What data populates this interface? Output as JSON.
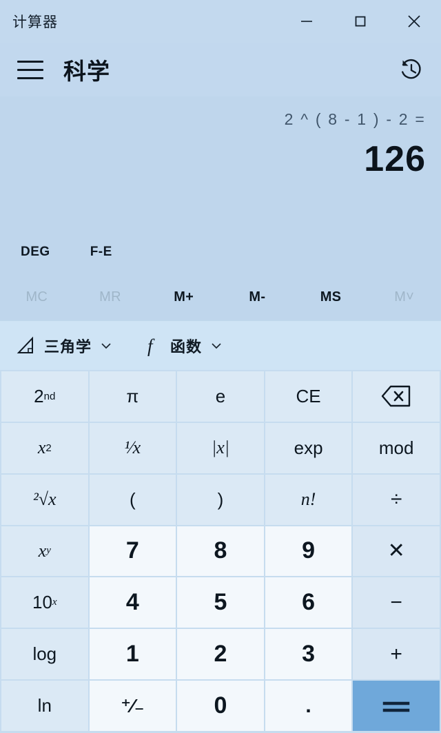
{
  "window": {
    "title": "计算器",
    "controls": [
      {
        "name": "minimize",
        "label": "—"
      },
      {
        "name": "maximize",
        "label": "□"
      },
      {
        "name": "close",
        "label": "✕"
      }
    ]
  },
  "header": {
    "menu_icon": "hamburger-icon",
    "mode_title": "科学",
    "history_icon": "history-icon"
  },
  "display": {
    "expression": "2 ^ ( 8 - 1 ) - 2 =",
    "result": "126"
  },
  "toggles": [
    {
      "label": "DEG",
      "name": "angle-unit-toggle",
      "enabled": true
    },
    {
      "label": "F-E",
      "name": "fixed-exponential-toggle",
      "enabled": true
    }
  ],
  "memory": [
    {
      "label": "MC",
      "name": "memory-clear",
      "enabled": false
    },
    {
      "label": "MR",
      "name": "memory-recall",
      "enabled": false
    },
    {
      "label": "M+",
      "name": "memory-add",
      "enabled": true
    },
    {
      "label": "M-",
      "name": "memory-subtract",
      "enabled": true
    },
    {
      "label": "MS",
      "name": "memory-store",
      "enabled": true
    },
    {
      "label": "M˅",
      "name": "memory-list",
      "enabled": false
    }
  ],
  "toolbar": [
    {
      "label": "三角学",
      "name": "trigonometry-menu",
      "icon": "triangle-icon"
    },
    {
      "label": "函数",
      "name": "function-menu",
      "icon": "function-f-icon"
    }
  ],
  "keypad": {
    "rows": [
      [
        {
          "name": "second-function",
          "text": "2",
          "sup": "nd",
          "kind": "fn"
        },
        {
          "name": "pi",
          "text": "π",
          "kind": "fn"
        },
        {
          "name": "euler-e",
          "text": "e",
          "kind": "fn"
        },
        {
          "name": "clear-entry",
          "text": "CE",
          "kind": "fn"
        },
        {
          "name": "backspace",
          "icon": "backspace-icon",
          "kind": "fn"
        }
      ],
      [
        {
          "name": "square",
          "text": "x",
          "sup": "2",
          "italic": true,
          "kind": "fn"
        },
        {
          "name": "reciprocal",
          "text": "¹⁄x",
          "italic": true,
          "kind": "fn"
        },
        {
          "name": "absolute-value",
          "text": "|x|",
          "italic": true,
          "kind": "fn"
        },
        {
          "name": "exponent",
          "text": "exp",
          "kind": "fn"
        },
        {
          "name": "modulo",
          "text": "mod",
          "kind": "fn"
        }
      ],
      [
        {
          "name": "square-root",
          "text": "²√x",
          "italic": true,
          "kind": "fn"
        },
        {
          "name": "open-paren",
          "text": "(",
          "kind": "fn"
        },
        {
          "name": "close-paren",
          "text": ")",
          "kind": "fn"
        },
        {
          "name": "factorial",
          "text": "n!",
          "italic": true,
          "kind": "fn"
        },
        {
          "name": "divide",
          "text": "÷",
          "kind": "op"
        }
      ],
      [
        {
          "name": "x-power-y",
          "text": "x",
          "sup": "y",
          "italic": true,
          "kind": "fn"
        },
        {
          "name": "digit-7",
          "text": "7",
          "kind": "num"
        },
        {
          "name": "digit-8",
          "text": "8",
          "kind": "num"
        },
        {
          "name": "digit-9",
          "text": "9",
          "kind": "num"
        },
        {
          "name": "multiply",
          "text": "✕",
          "kind": "op"
        }
      ],
      [
        {
          "name": "ten-power-x",
          "text": "10",
          "sup": "x",
          "kind": "fn"
        },
        {
          "name": "digit-4",
          "text": "4",
          "kind": "num"
        },
        {
          "name": "digit-5",
          "text": "5",
          "kind": "num"
        },
        {
          "name": "digit-6",
          "text": "6",
          "kind": "num"
        },
        {
          "name": "subtract",
          "text": "−",
          "kind": "op"
        }
      ],
      [
        {
          "name": "log-base-10",
          "text": "log",
          "kind": "fn"
        },
        {
          "name": "digit-1",
          "text": "1",
          "kind": "num"
        },
        {
          "name": "digit-2",
          "text": "2",
          "kind": "num"
        },
        {
          "name": "digit-3",
          "text": "3",
          "kind": "num"
        },
        {
          "name": "add",
          "text": "+",
          "kind": "op"
        }
      ],
      [
        {
          "name": "natural-log",
          "text": "ln",
          "kind": "fn"
        },
        {
          "name": "sign-toggle",
          "text": "⁺⁄₋",
          "kind": "num"
        },
        {
          "name": "digit-0",
          "text": "0",
          "kind": "num"
        },
        {
          "name": "decimal-point",
          "text": ".",
          "kind": "num"
        },
        {
          "name": "equals",
          "text": "=",
          "kind": "equals"
        }
      ]
    ]
  },
  "colors": {
    "window_bg": "#c3d9ee",
    "display_bg": "#bfd6ec",
    "toolbar_bg": "#cfe4f5",
    "key_fn_bg": "#dbe9f5",
    "key_num_bg": "#f3f8fc",
    "accent": "#6fa8da",
    "text": "#0d1720",
    "text_disabled": "#9fb6c9"
  }
}
